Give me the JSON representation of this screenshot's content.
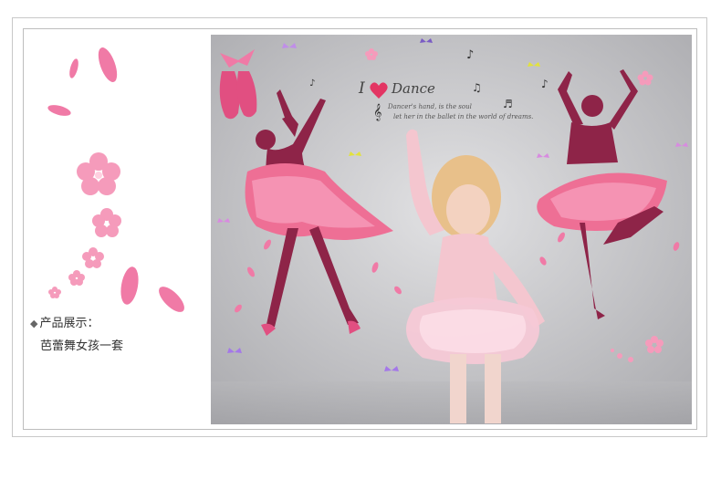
{
  "caption": {
    "bullet_icon": "diamond-icon",
    "label": "产品展示："
  },
  "product_name": "芭蕾舞女孩一套",
  "wall_text": {
    "title_i": "I",
    "title_dance": "Dance",
    "line1": "Dancer's hand, is the soul",
    "line2": "let her in the ballet in the world of dreams."
  },
  "colors": {
    "petal_pink": "#f07aa6",
    "dancer_maroon": "#8e2448",
    "tutu_pink": "#ee6f95",
    "wall_gray": "#c9c9cb"
  }
}
